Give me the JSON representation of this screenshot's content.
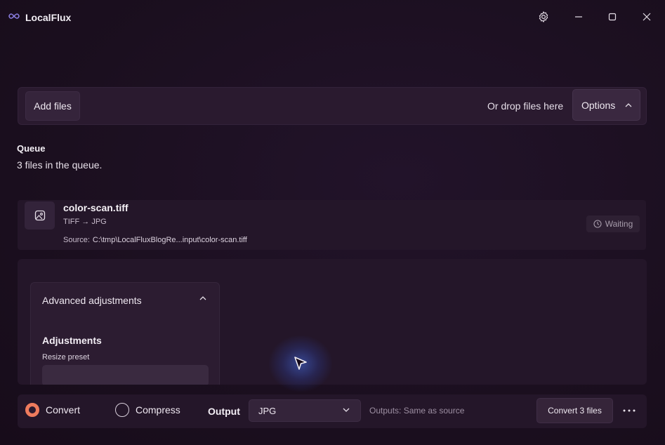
{
  "app": {
    "title": "LocalFlux"
  },
  "toolbar": {
    "add_files": "Add files",
    "drop_hint": "Or drop files here",
    "options": "Options"
  },
  "queue": {
    "title": "Queue",
    "count_text": "3 files in the queue."
  },
  "file": {
    "name": "color-scan.tiff",
    "formats": "TIFF → JPG",
    "source_label": "Source:",
    "source_path": "C:\\tmp\\LocalFluxBlogRe...input\\color-scan.tiff",
    "status": "Waiting"
  },
  "adjustments": {
    "header": "Advanced adjustments",
    "section_title": "Adjustments",
    "resize_label": "Resize preset"
  },
  "bottom": {
    "convert_label": "Convert",
    "compress_label": "Compress",
    "selected_mode": "Convert",
    "output_label": "Output",
    "output_value": "JPG",
    "outputs_hint": "Outputs: Same as source",
    "convert_button": "Convert 3 files"
  },
  "colors": {
    "accent": "#ee7b5d",
    "background": "#1b0f1f",
    "surface": "#241629"
  },
  "icons": {
    "logo": "infinity-logo-icon",
    "settings": "gear-icon",
    "minimize": "minimize-icon",
    "maximize": "maximize-icon",
    "close": "close-icon",
    "file": "image-icon",
    "status": "clock-icon",
    "more": "more-horizontal-icon"
  }
}
